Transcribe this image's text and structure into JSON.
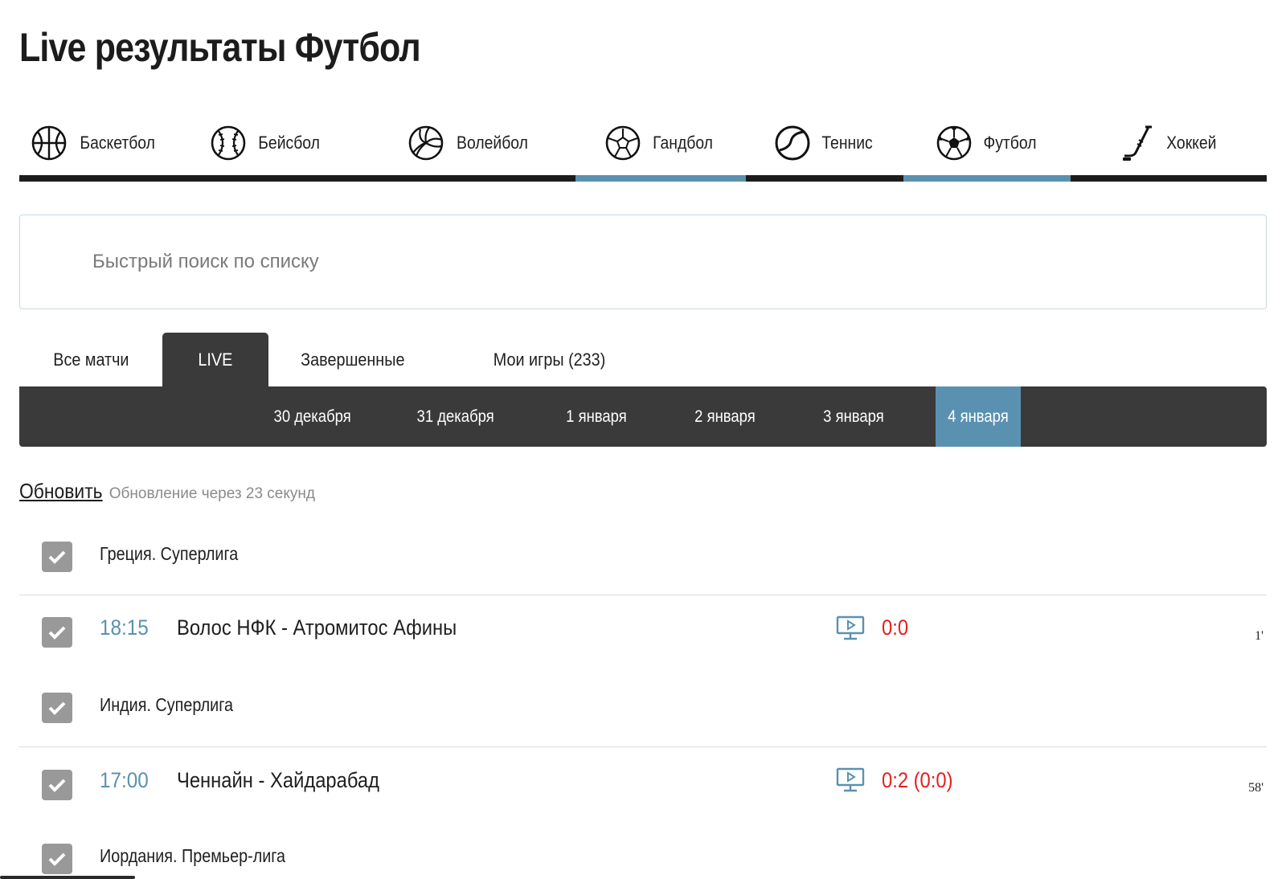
{
  "page": {
    "title": "Live результаты Футбол"
  },
  "sports": [
    {
      "label": "Баскетбол",
      "icon": "basketball-icon"
    },
    {
      "label": "Бейсбол",
      "icon": "baseball-icon"
    },
    {
      "label": "Волейбол",
      "icon": "volleyball-icon"
    },
    {
      "label": "Гандбол",
      "icon": "handball-icon"
    },
    {
      "label": "Теннис",
      "icon": "tennis-icon"
    },
    {
      "label": "Футбол",
      "icon": "football-icon"
    },
    {
      "label": "Хоккей",
      "icon": "hockey-icon"
    }
  ],
  "search": {
    "placeholder": "Быстрый поиск по списку",
    "value": ""
  },
  "filter_tabs": [
    {
      "label": "Все матчи",
      "active": false
    },
    {
      "label": "LIVE",
      "active": true
    },
    {
      "label": "Завершенные",
      "active": false
    },
    {
      "label": "Мои игры (233)",
      "active": false
    }
  ],
  "dates": [
    {
      "label": "30 декабря",
      "active": false
    },
    {
      "label": "31 декабря",
      "active": false
    },
    {
      "label": "1 января",
      "active": false
    },
    {
      "label": "2 января",
      "active": false
    },
    {
      "label": "3 января",
      "active": false
    },
    {
      "label": "4 января",
      "active": true
    }
  ],
  "refresh": {
    "link": "Обновить",
    "note": "Обновление через 23 секунд"
  },
  "leagues": [
    {
      "name": "Греция. Суперлига",
      "checked": true
    },
    {
      "name": "Индия. Суперлига",
      "checked": true
    },
    {
      "name": "Иордания. Премьер-лига",
      "checked": true
    }
  ],
  "matches": [
    {
      "time": "18:15",
      "teams": "Волос НФК - Атромитос Афины",
      "score": "0:0",
      "minute": "1'",
      "checked": true
    },
    {
      "time": "17:00",
      "teams": "Ченнайн - Хайдарабад",
      "score": "0:2 (0:0)",
      "minute": "58'",
      "checked": true
    }
  ],
  "colors": {
    "accent": "#5b91b0",
    "dark": "#3a3a3a",
    "score": "#e5201d",
    "checkbox": "#999999"
  }
}
